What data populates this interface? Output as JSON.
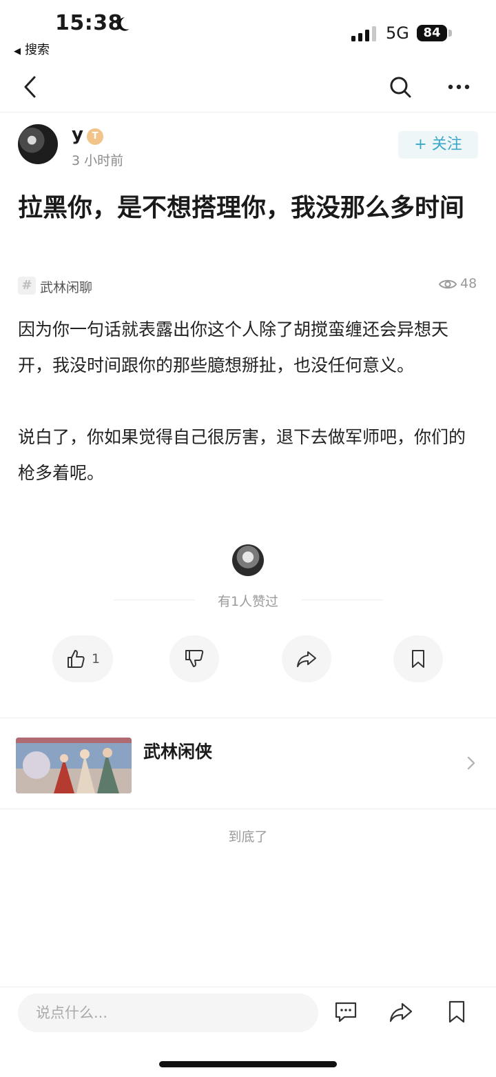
{
  "status_bar": {
    "time": "15:38",
    "back_app": "搜索",
    "network": "5G",
    "battery": "84"
  },
  "author": {
    "name": "y",
    "badge": "T",
    "time_ago": "3 小时前",
    "follow_label": "+ 关注"
  },
  "post": {
    "title": "拉黑你，是不想搭理你，我没那么多时间",
    "topic": "武林闲聊",
    "views": "48",
    "paragraphs": [
      "因为你一句话就表露出你这个人除了胡搅蛮缠还会异想天开，我没时间跟你的那些臆想掰扯，也没任何意义。",
      "说白了，你如果觉得自己很厉害，退下去做军师吧，你们的枪多着呢。"
    ]
  },
  "likes": {
    "summary": "有1人赞过",
    "count": "1"
  },
  "game_card": {
    "title": "武林闲侠"
  },
  "end_text": "到底了",
  "bottom_bar": {
    "input_placeholder": "说点什么..."
  },
  "icons": {
    "moon": "moon-icon",
    "signal": "signal-icon",
    "back": "back-arrow-icon",
    "search": "search-icon",
    "more": "more-icon",
    "eye": "eye-icon",
    "like": "thumbs-up-icon",
    "dislike": "thumbs-down-icon",
    "share": "share-icon",
    "save": "bookmark-icon",
    "comment": "comment-icon",
    "chevron": "chevron-right-icon"
  },
  "colors": {
    "accent": "#3aa7c9",
    "follow_bg": "#eef6f8",
    "badge": "#f2c48a"
  }
}
